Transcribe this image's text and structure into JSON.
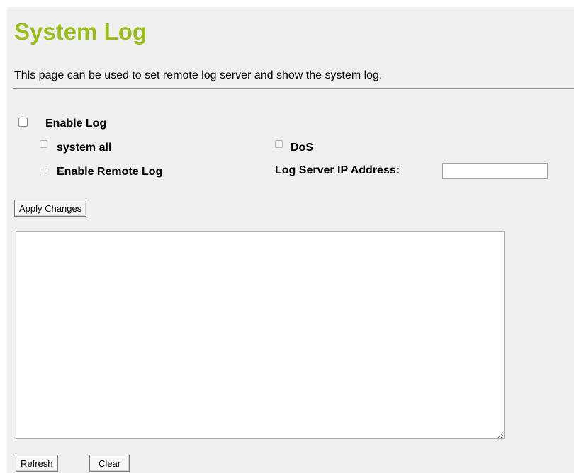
{
  "page": {
    "title": "System Log",
    "description": "This page can be used to set remote log server and show the system log.",
    "title_color": "#9bbc1f"
  },
  "options": {
    "enable_log": {
      "label": "Enable Log",
      "checked": false
    },
    "system_all": {
      "label": "system all",
      "checked": false,
      "disabled": true
    },
    "dos": {
      "label": "DoS",
      "checked": false,
      "disabled": true
    },
    "enable_remote_log": {
      "label": "Enable Remote Log",
      "checked": false,
      "disabled": true
    },
    "log_server_ip": {
      "label": "Log Server IP Address:",
      "value": ""
    }
  },
  "buttons": {
    "apply": "Apply Changes",
    "refresh": "Refresh",
    "clear": "Clear"
  },
  "log": {
    "content": ""
  }
}
